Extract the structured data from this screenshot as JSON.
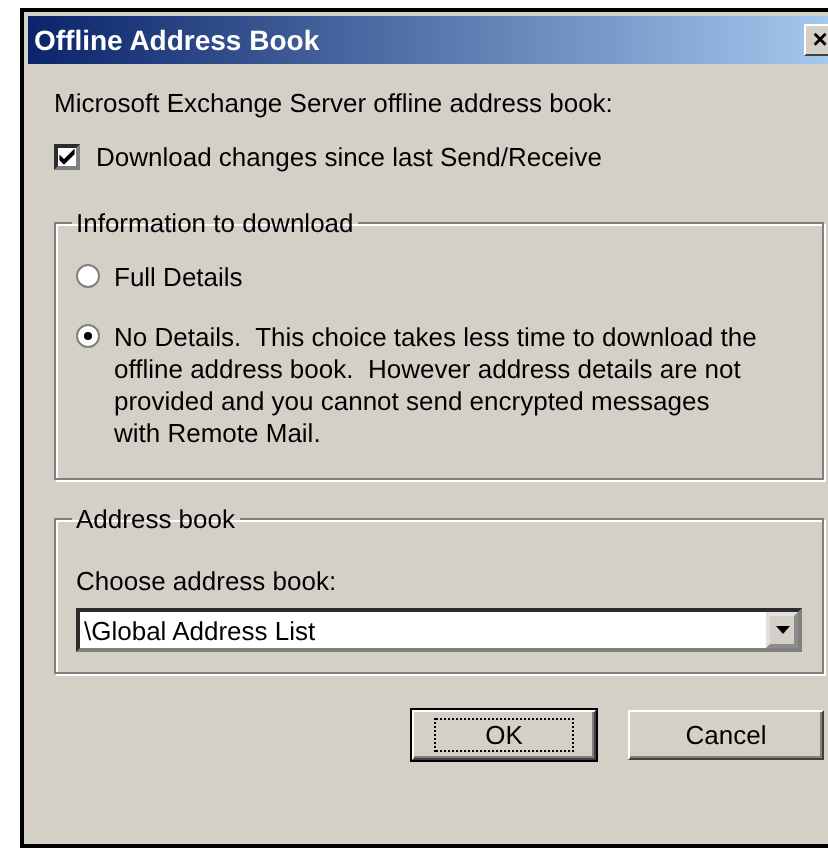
{
  "window": {
    "title": "Offline Address Book",
    "close": "×"
  },
  "intro": "Microsoft Exchange Server offline address book:",
  "download_changes": {
    "label": "Download changes since last Send/Receive",
    "checked": true
  },
  "information_group": {
    "title": "Information to download",
    "options": [
      {
        "label": "Full Details",
        "selected": false
      },
      {
        "label": "No Details.  This choice takes less time to download the offline address book.  However address details are not provided and you cannot send encrypted messages with Remote Mail.",
        "selected": true
      }
    ]
  },
  "address_group": {
    "title": "Address book",
    "label": "Choose address book:",
    "value": "\\Global Address List"
  },
  "buttons": [
    {
      "label": "OK",
      "focused": true
    },
    {
      "label": "Cancel",
      "focused": false
    }
  ]
}
